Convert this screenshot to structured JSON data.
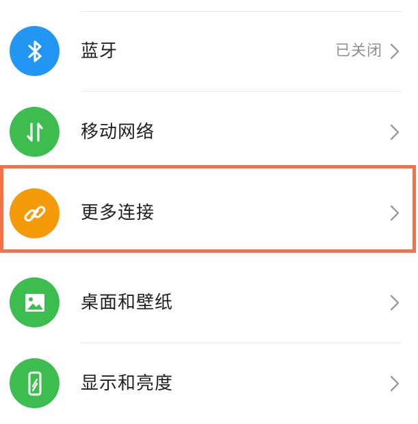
{
  "settings": {
    "items": [
      {
        "label": "蓝牙",
        "value": "已关闭",
        "icon": "bluetooth-icon",
        "icon_color": "#2196f3"
      },
      {
        "label": "移动网络",
        "value": "",
        "icon": "mobile-data-icon",
        "icon_color": "#3dbd50"
      },
      {
        "label": "更多连接",
        "value": "",
        "icon": "link-icon",
        "icon_color": "#f59b0a"
      },
      {
        "label": "桌面和壁纸",
        "value": "",
        "icon": "wallpaper-icon",
        "icon_color": "#3dbd50"
      },
      {
        "label": "显示和亮度",
        "value": "",
        "icon": "display-icon",
        "icon_color": "#3dbd50"
      }
    ]
  },
  "highlight": {
    "color": "#f0734a",
    "target": "更多连接"
  }
}
